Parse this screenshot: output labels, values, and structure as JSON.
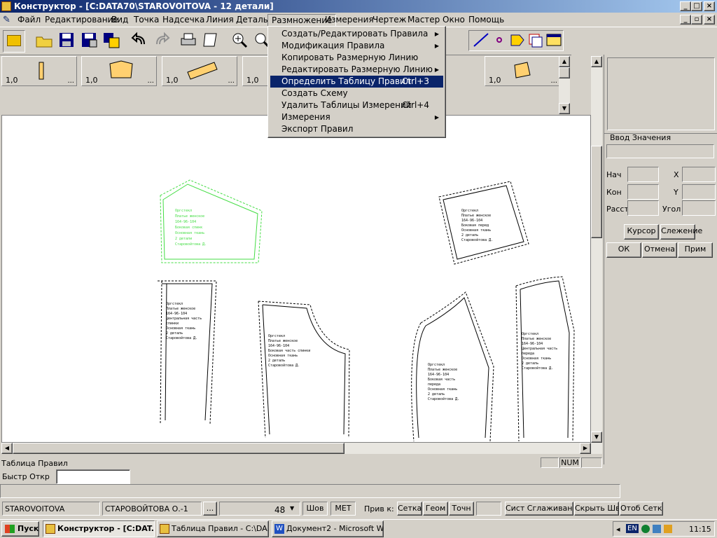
{
  "window": {
    "title": "Конструктор - [C:DATA70\\STAROVOITOVA - 12 детали]"
  },
  "menu": [
    "Файл",
    "Редактирование",
    "Вид",
    "Точка",
    "Надсечка",
    "Линия",
    "Деталь",
    "Размножение",
    "Измерения",
    "Чертеж",
    "Мастер",
    "Окно",
    "Помощь"
  ],
  "dropdown": [
    {
      "label": "Создать/Редактировать Правила",
      "shortcut": "",
      "submenu": true,
      "highlighted": false
    },
    {
      "label": "Модификация Правила",
      "shortcut": "",
      "submenu": true,
      "highlighted": false
    },
    {
      "label": "Копировать Размерную Линию",
      "shortcut": "",
      "submenu": false,
      "highlighted": false
    },
    {
      "label": "Редактировать Размерную Линию",
      "shortcut": "",
      "submenu": true,
      "highlighted": false
    },
    {
      "label": "Определить Таблицу Правил",
      "shortcut": "Ctrl+3",
      "submenu": false,
      "highlighted": true
    },
    {
      "label": "Создать Схему",
      "shortcut": "",
      "submenu": false,
      "highlighted": false
    },
    {
      "label": "Удалить Таблицы Измерений",
      "shortcut": "Ctrl+4",
      "submenu": false,
      "highlighted": false
    },
    {
      "label": "Измерения",
      "shortcut": "",
      "submenu": true,
      "highlighted": false
    },
    {
      "label": "Экспорт Правил",
      "shortcut": "",
      "submenu": false,
      "highlighted": false
    }
  ],
  "pieces": {
    "scale": [
      "1,0",
      "1,0",
      "1,0",
      "1,0",
      "1,0"
    ],
    "dots": "..."
  },
  "right_panel": {
    "group_title": "Ввод Значения",
    "labels": {
      "nach": "Нач",
      "kon": "Кон",
      "rast": "Расст",
      "x": "X",
      "y": "Y",
      "ugol": "Угол"
    },
    "buttons": {
      "cursor": "Курсор",
      "track": "Слежение",
      "ok": "ОК",
      "cancel": "Отмена",
      "apply": "Прим"
    }
  },
  "status": {
    "table_rules": "Таблица Правил",
    "num": "NUM",
    "quick_open": "Быстр Откр"
  },
  "bottom": {
    "model": "STAROVOITOVA",
    "author": "СТАРОВОЙТОВА О.-1",
    "browse": "...",
    "size": "48",
    "seam": "Шов",
    "unit": "МЕТ",
    "snap_label": "Прив к:",
    "grid": "Сетка",
    "geom": "Геом",
    "point": "Точн",
    "smooth": "Сист Сглаживание",
    "hide_seams": "Скрыть Швы",
    "show_grid": "Отоб Сетку"
  },
  "taskbar": {
    "start": "Пуск",
    "tasks": [
      "Конструктор - [C:DAT...",
      "Таблица Правил - C:\\DA...",
      "Документ2 - Microsoft W..."
    ],
    "lang": "EN",
    "clock": "11:15"
  },
  "pattern_text": {
    "a": [
      "Оргстекл",
      "Платье женское",
      "164-96-104",
      "Боковая спинк",
      "Основная ткань",
      "2 детали",
      "Старовойтова Д."
    ],
    "b": [
      "Оргстекл",
      "Платье женское",
      "164-96-104",
      "Боковая перед",
      "Основная ткань",
      "2 деталь",
      "Старовойтова Д."
    ],
    "c": [
      "Оргстекл",
      "Платье женское",
      "164-96-104",
      "Центральная часть",
      "спинки",
      "Основная ткань",
      "2 деталь",
      "Старовойтова Д."
    ],
    "d": [
      "Оргстекл",
      "Платье женское",
      "164-96-104",
      "Боковая часть спинки",
      "Основная ткань",
      "2 деталь",
      "Старовойтова Д."
    ],
    "e": [
      "Оргстекл",
      "Платье женское",
      "164-96-104",
      "Боковая часть",
      "переда",
      "Основная ткань",
      "2 деталь",
      "Старовойтова Д."
    ],
    "f": [
      "Оргстекл",
      "Платье женское",
      "164-96-104",
      "Центральная часть",
      "переда",
      "Основная ткань",
      "2 деталь",
      "Старовойтова Д."
    ]
  },
  "colors": {
    "title_start": "#0a246a",
    "highlight": "#0a246a",
    "selected_piece": "#44dd44",
    "canvas": "#ffffff"
  }
}
